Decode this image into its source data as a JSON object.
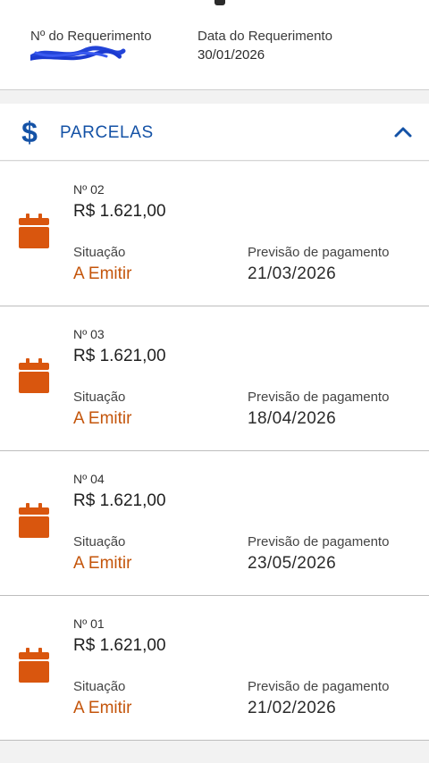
{
  "request": {
    "number_label": "Nº do Requerimento",
    "date_label": "Data do Requerimento",
    "date_value": "30/01/2026"
  },
  "section": {
    "title": "PARCELAS",
    "icon": "dollar-icon",
    "toggle_icon": "chevron-up-icon",
    "accent_color": "#1452a6"
  },
  "installments": [
    {
      "number": "Nº 02",
      "amount": "R$ 1.621,00",
      "status_label": "Situação",
      "status": "A Emitir",
      "forecast_label": "Previsão de pagamento",
      "forecast_date": "21/03/2026"
    },
    {
      "number": "Nº 03",
      "amount": "R$ 1.621,00",
      "status_label": "Situação",
      "status": "A Emitir",
      "forecast_label": "Previsão de pagamento",
      "forecast_date": "18/04/2026"
    },
    {
      "number": "Nº 04",
      "amount": "R$ 1.621,00",
      "status_label": "Situação",
      "status": "A Emitir",
      "forecast_label": "Previsão de pagamento",
      "forecast_date": "23/05/2026"
    },
    {
      "number": "Nº 01",
      "amount": "R$ 1.621,00",
      "status_label": "Situação",
      "status": "A Emitir",
      "forecast_label": "Previsão de pagamento",
      "forecast_date": "21/02/2026"
    }
  ],
  "colors": {
    "status": "#c4550b",
    "calendar_icon": "#d9560e"
  }
}
